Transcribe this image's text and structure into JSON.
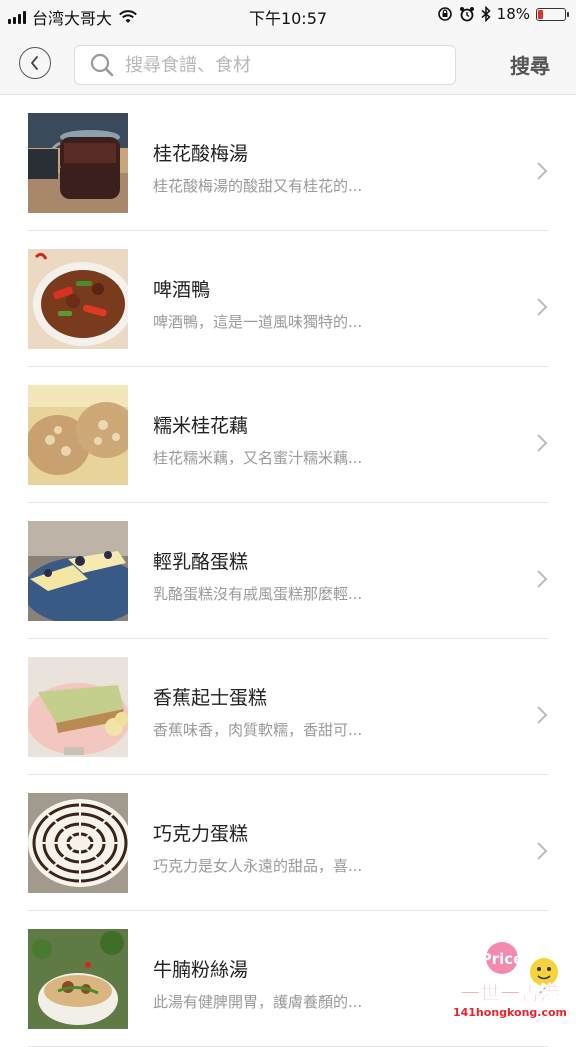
{
  "status_bar": {
    "carrier": "台湾大哥大",
    "time": "下午10:57",
    "battery_percent": "18%",
    "battery_level": 0.18
  },
  "nav": {
    "search_placeholder": "搜尋食譜、食材",
    "search_button": "搜尋"
  },
  "recipes": [
    {
      "title": "桂花酸梅湯",
      "desc": "桂花酸梅湯的酸甜又有桂花的..."
    },
    {
      "title": "啤酒鴨",
      "desc": "啤酒鴨，這是一道風味獨特的..."
    },
    {
      "title": "糯米桂花藕",
      "desc": "桂花糯米藕，又名蜜汁糯米藕..."
    },
    {
      "title": "輕乳酪蛋糕",
      "desc": "乳酪蛋糕沒有戚風蛋糕那麼輕..."
    },
    {
      "title": "香蕉起士蛋糕",
      "desc": "香蕉味香，肉質軟糯，香甜可..."
    },
    {
      "title": "巧克力蛋糕",
      "desc": "巧克力是女人永遠的甜品，喜..."
    },
    {
      "title": "牛腩粉絲湯",
      "desc": "此湯有健脾開胃，護膚養顏的..."
    }
  ],
  "watermark": {
    "brand": "Price",
    "slogan": "一世一香港",
    "site": "141hongkong.com"
  }
}
